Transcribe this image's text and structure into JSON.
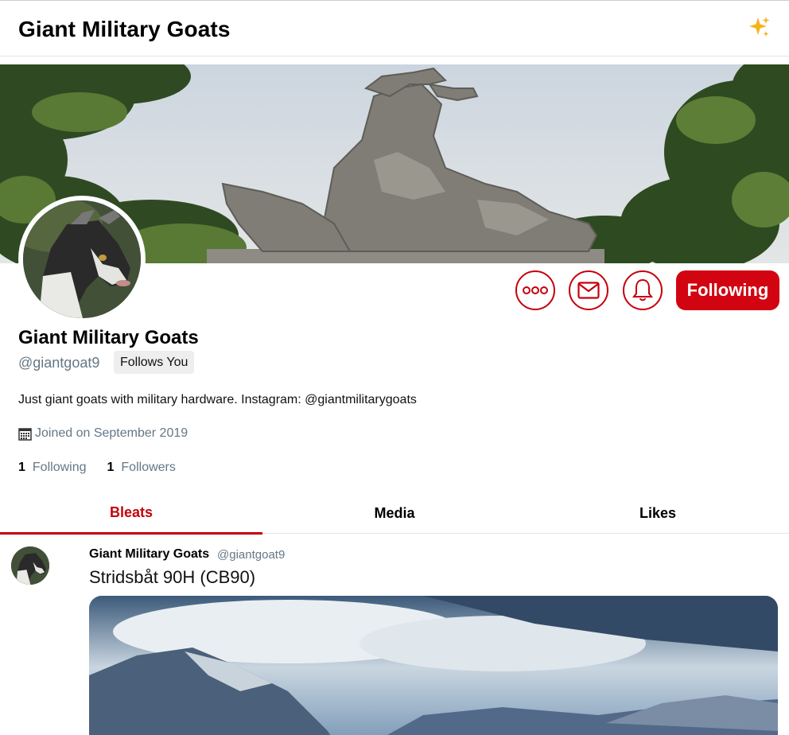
{
  "header": {
    "title": "Giant Military Goats",
    "icon": "sparkles-icon"
  },
  "profile": {
    "name": "Giant Military Goats",
    "handle": "@giantgoat9",
    "follows_you": "Follows You",
    "bio": "Just giant goats with military hardware. Instagram: @giantmilitarygoats",
    "joined": "Joined on September 2019",
    "following_count": "1",
    "following_label": "Following",
    "followers_count": "1",
    "followers_label": "Followers"
  },
  "actions": {
    "more_icon": "more-options-icon",
    "mail_icon": "mail-icon",
    "bell_icon": "notification-bell-icon",
    "follow_label": "Following"
  },
  "tabs": [
    {
      "label": "Bleats",
      "active": true
    },
    {
      "label": "Media",
      "active": false
    },
    {
      "label": "Likes",
      "active": false
    }
  ],
  "post": {
    "author": "Giant Military Goats",
    "handle": "@giantgoat9",
    "text": "Stridsbåt 90H (CB90)"
  },
  "colors": {
    "accent": "#c4000a",
    "follow_button": "#d20411",
    "muted_text": "#657786",
    "badge_bg": "#eeeeee"
  }
}
